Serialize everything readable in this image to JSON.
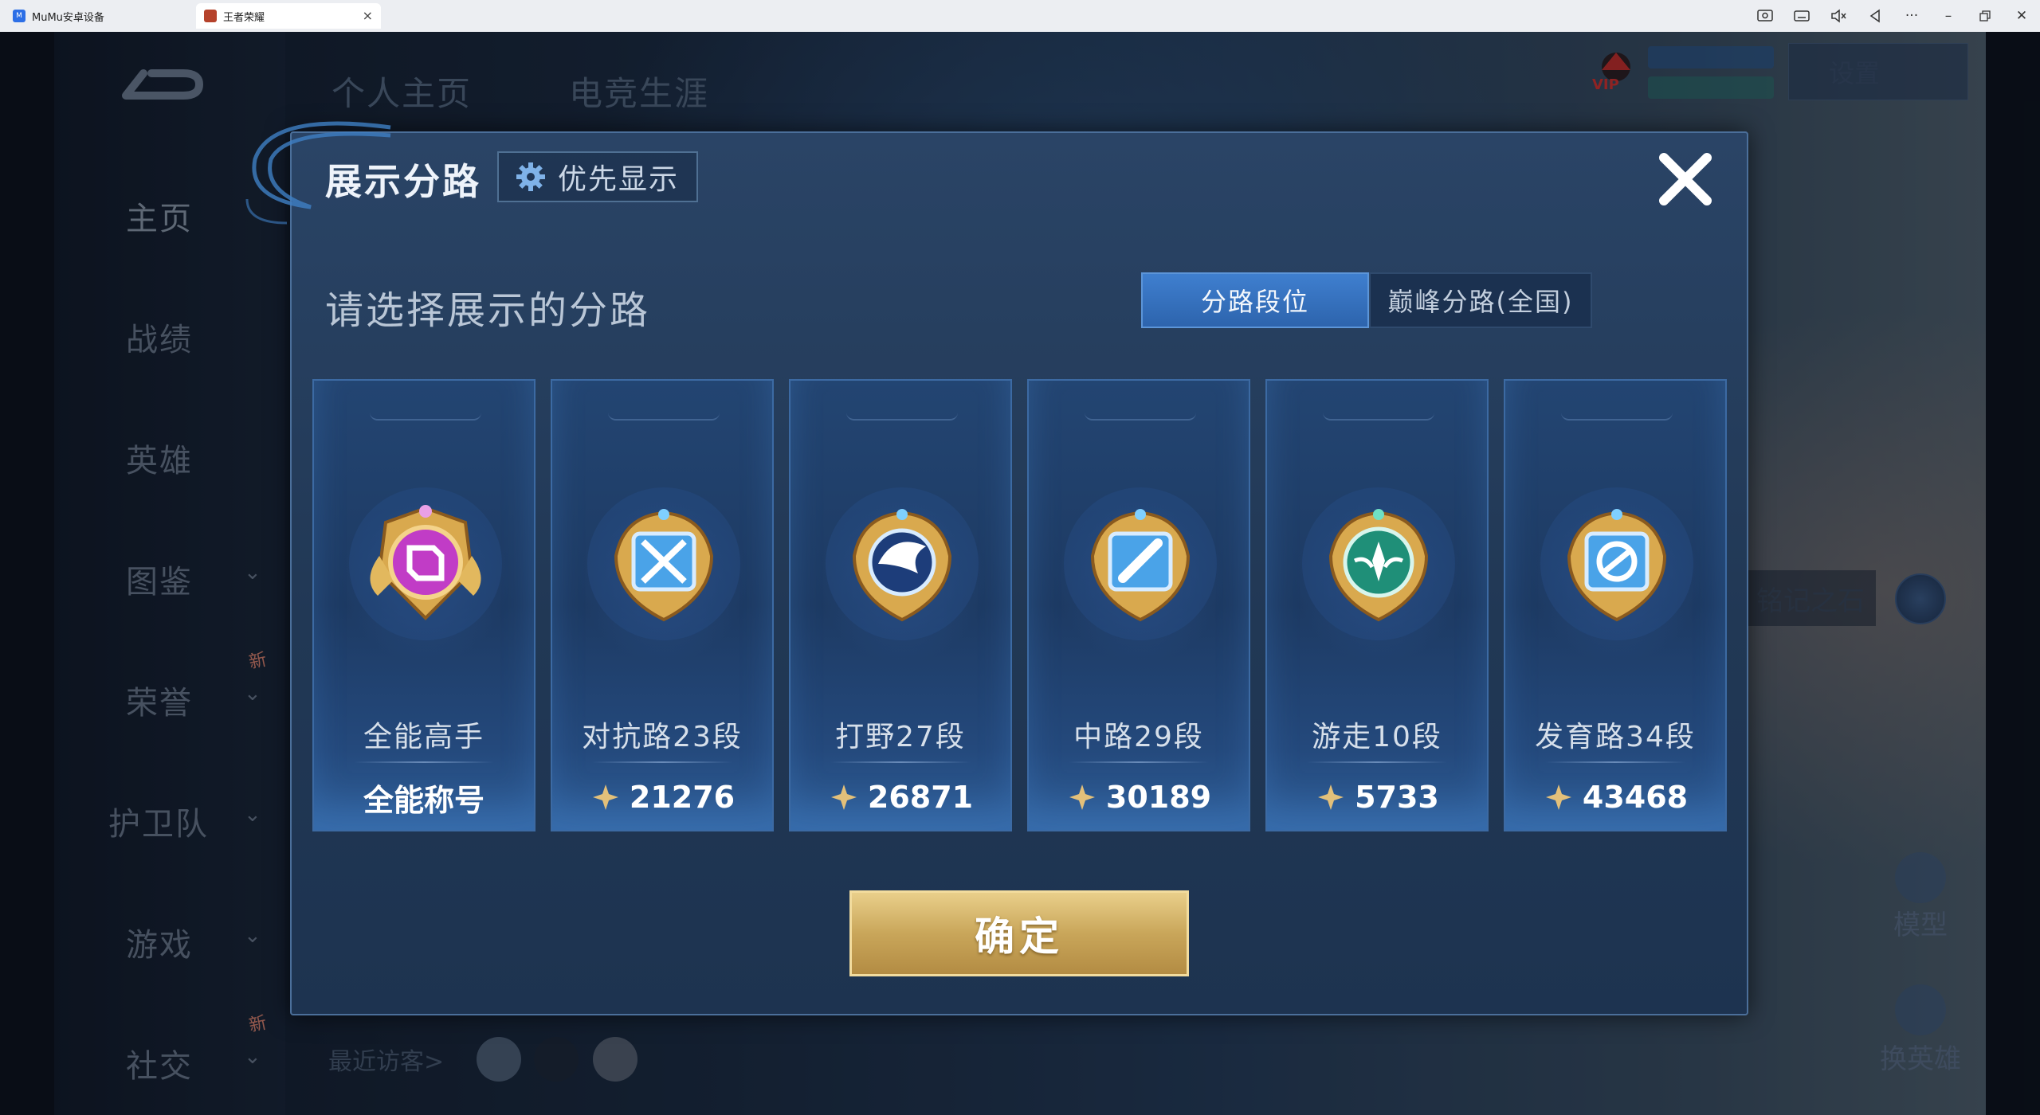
{
  "browser": {
    "tabs": [
      {
        "label": "MuMu安卓设备",
        "favicon": "mumu-icon"
      },
      {
        "label": "王者荣耀",
        "favicon": "game-icon",
        "active": true
      }
    ],
    "icons": [
      "screenshot-icon",
      "keyboard-icon",
      "mute-icon",
      "back-icon",
      "more-icon",
      "minimize-icon",
      "restore-icon",
      "close-icon"
    ]
  },
  "background": {
    "top_tabs": [
      "个人主页",
      "电竞生涯"
    ],
    "nav": [
      "主页",
      "战绩",
      "英雄",
      "图鉴",
      "荣誉",
      "护卫队",
      "游戏",
      "社交"
    ],
    "new_badge": "新",
    "vip": "VIP",
    "top_right_button": "设置",
    "stone_label": "铭记之石",
    "side_buttons": [
      "模型",
      "换英雄"
    ],
    "visitors_label": "最近访客>"
  },
  "dialog": {
    "title": "展示分路",
    "priority_label": "优先显示",
    "subtitle": "请选择展示的分路",
    "segments": [
      "分路段位",
      "巅峰分路(全国)"
    ],
    "active_segment": 0,
    "cards": [
      {
        "name": "全能高手",
        "value": "全能称号",
        "emblem": "all-round-emblem-icon",
        "has_points_icon": false
      },
      {
        "name": "对抗路23段",
        "value": "21276",
        "emblem": "clash-lane-emblem-icon",
        "has_points_icon": true
      },
      {
        "name": "打野27段",
        "value": "26871",
        "emblem": "jungle-emblem-icon",
        "has_points_icon": true
      },
      {
        "name": "中路29段",
        "value": "30189",
        "emblem": "mid-lane-emblem-icon",
        "has_points_icon": true
      },
      {
        "name": "游走10段",
        "value": "5733",
        "emblem": "roam-emblem-icon",
        "has_points_icon": true
      },
      {
        "name": "发育路34段",
        "value": "43468",
        "emblem": "farm-lane-emblem-icon",
        "has_points_icon": true
      }
    ],
    "confirm_label": "确定"
  },
  "colors": {
    "dialog_bg": "#213855",
    "active_segment": "#3f7fcf",
    "confirm_gold": "#c9a65a"
  }
}
